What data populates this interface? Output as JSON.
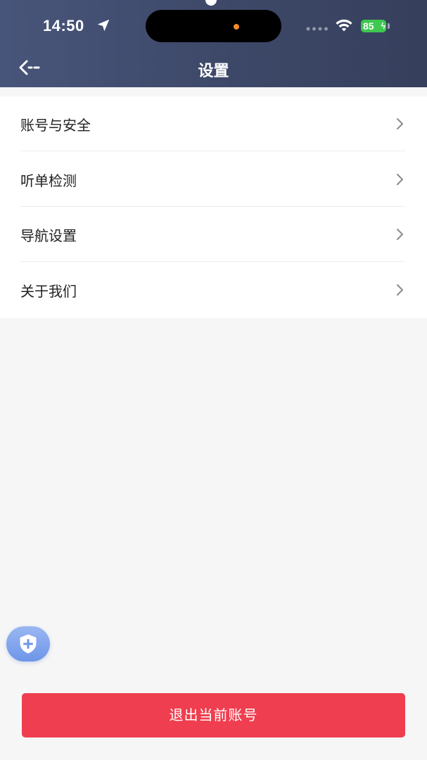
{
  "status_bar": {
    "time": "14:50",
    "battery": "85"
  },
  "header": {
    "title": "设置"
  },
  "menu": {
    "items": [
      {
        "label": "账号与安全"
      },
      {
        "label": "听单检测"
      },
      {
        "label": "导航设置"
      },
      {
        "label": "关于我们"
      }
    ]
  },
  "footer": {
    "logout_label": "退出当前账号"
  },
  "colors": {
    "header_bg": "#3f4a6c",
    "page_bg": "#f6f6f7",
    "logout_bg": "#ef3e4f",
    "battery_green": "#3ec84f",
    "shield_button": "#7b9ee9"
  },
  "icons": {
    "back": "back-arrow-icon",
    "chevron": "chevron-right-icon",
    "shield": "shield-plus-icon",
    "location": "location-arrow-icon",
    "wifi": "wifi-icon"
  }
}
